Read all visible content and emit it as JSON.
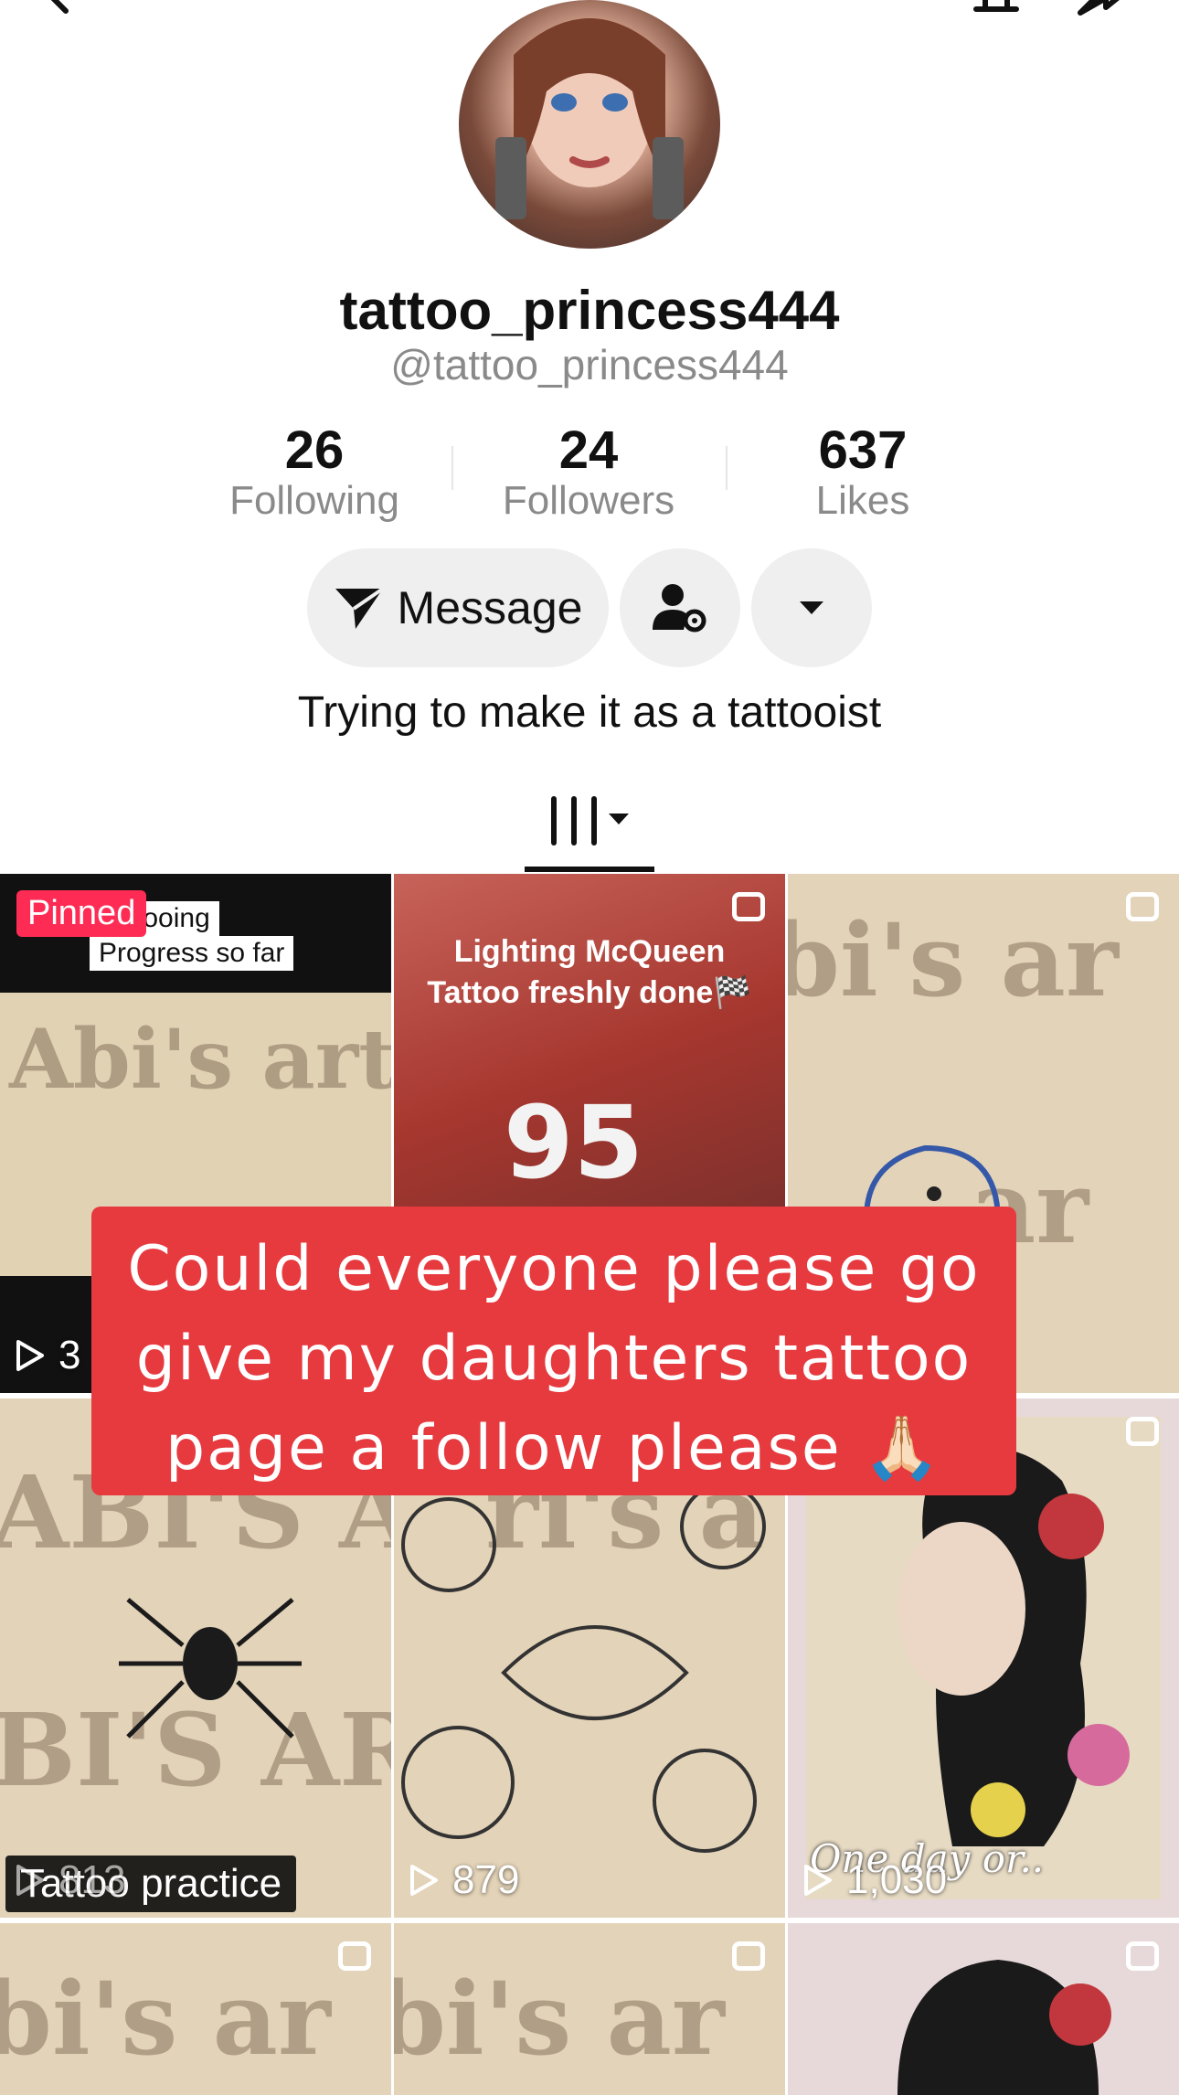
{
  "profile": {
    "username": "tattoo_princess444",
    "handle": "@tattoo_princess444",
    "bio": "Trying to make it as a tattooist"
  },
  "stats": [
    {
      "value": "26",
      "label": "Following"
    },
    {
      "value": "24",
      "label": "Followers"
    },
    {
      "value": "637",
      "label": "Likes"
    }
  ],
  "actions": {
    "message_label": "Message"
  },
  "icons": [
    "back-icon",
    "bell-icon",
    "share-icon",
    "send-icon",
    "user-settings-icon",
    "caret-down-icon",
    "grid-icon",
    "play-icon",
    "multi-photo-icon"
  ],
  "posts": {
    "p1": {
      "badge": "Pinned",
      "caption1": "Tattooing",
      "caption2": "Progress so far",
      "views": "3"
    },
    "p2": {
      "caption1": "Lighting McQueen",
      "caption2": "Tattoo freshly done🏁"
    },
    "p4": {
      "caption": "Tattoo practice",
      "views": "813"
    },
    "p5": {
      "views": "879"
    },
    "p6": {
      "caption": "One day or..",
      "views": "1,030"
    }
  },
  "overlay": {
    "line1": "Could everyone please go",
    "line2": "give my daughters tattoo",
    "line3": "page a follow please 🙏🏻"
  },
  "colors": {
    "accent": "#fe2c55",
    "banner": "#e63a3f",
    "muted": "#8a8a8a"
  }
}
